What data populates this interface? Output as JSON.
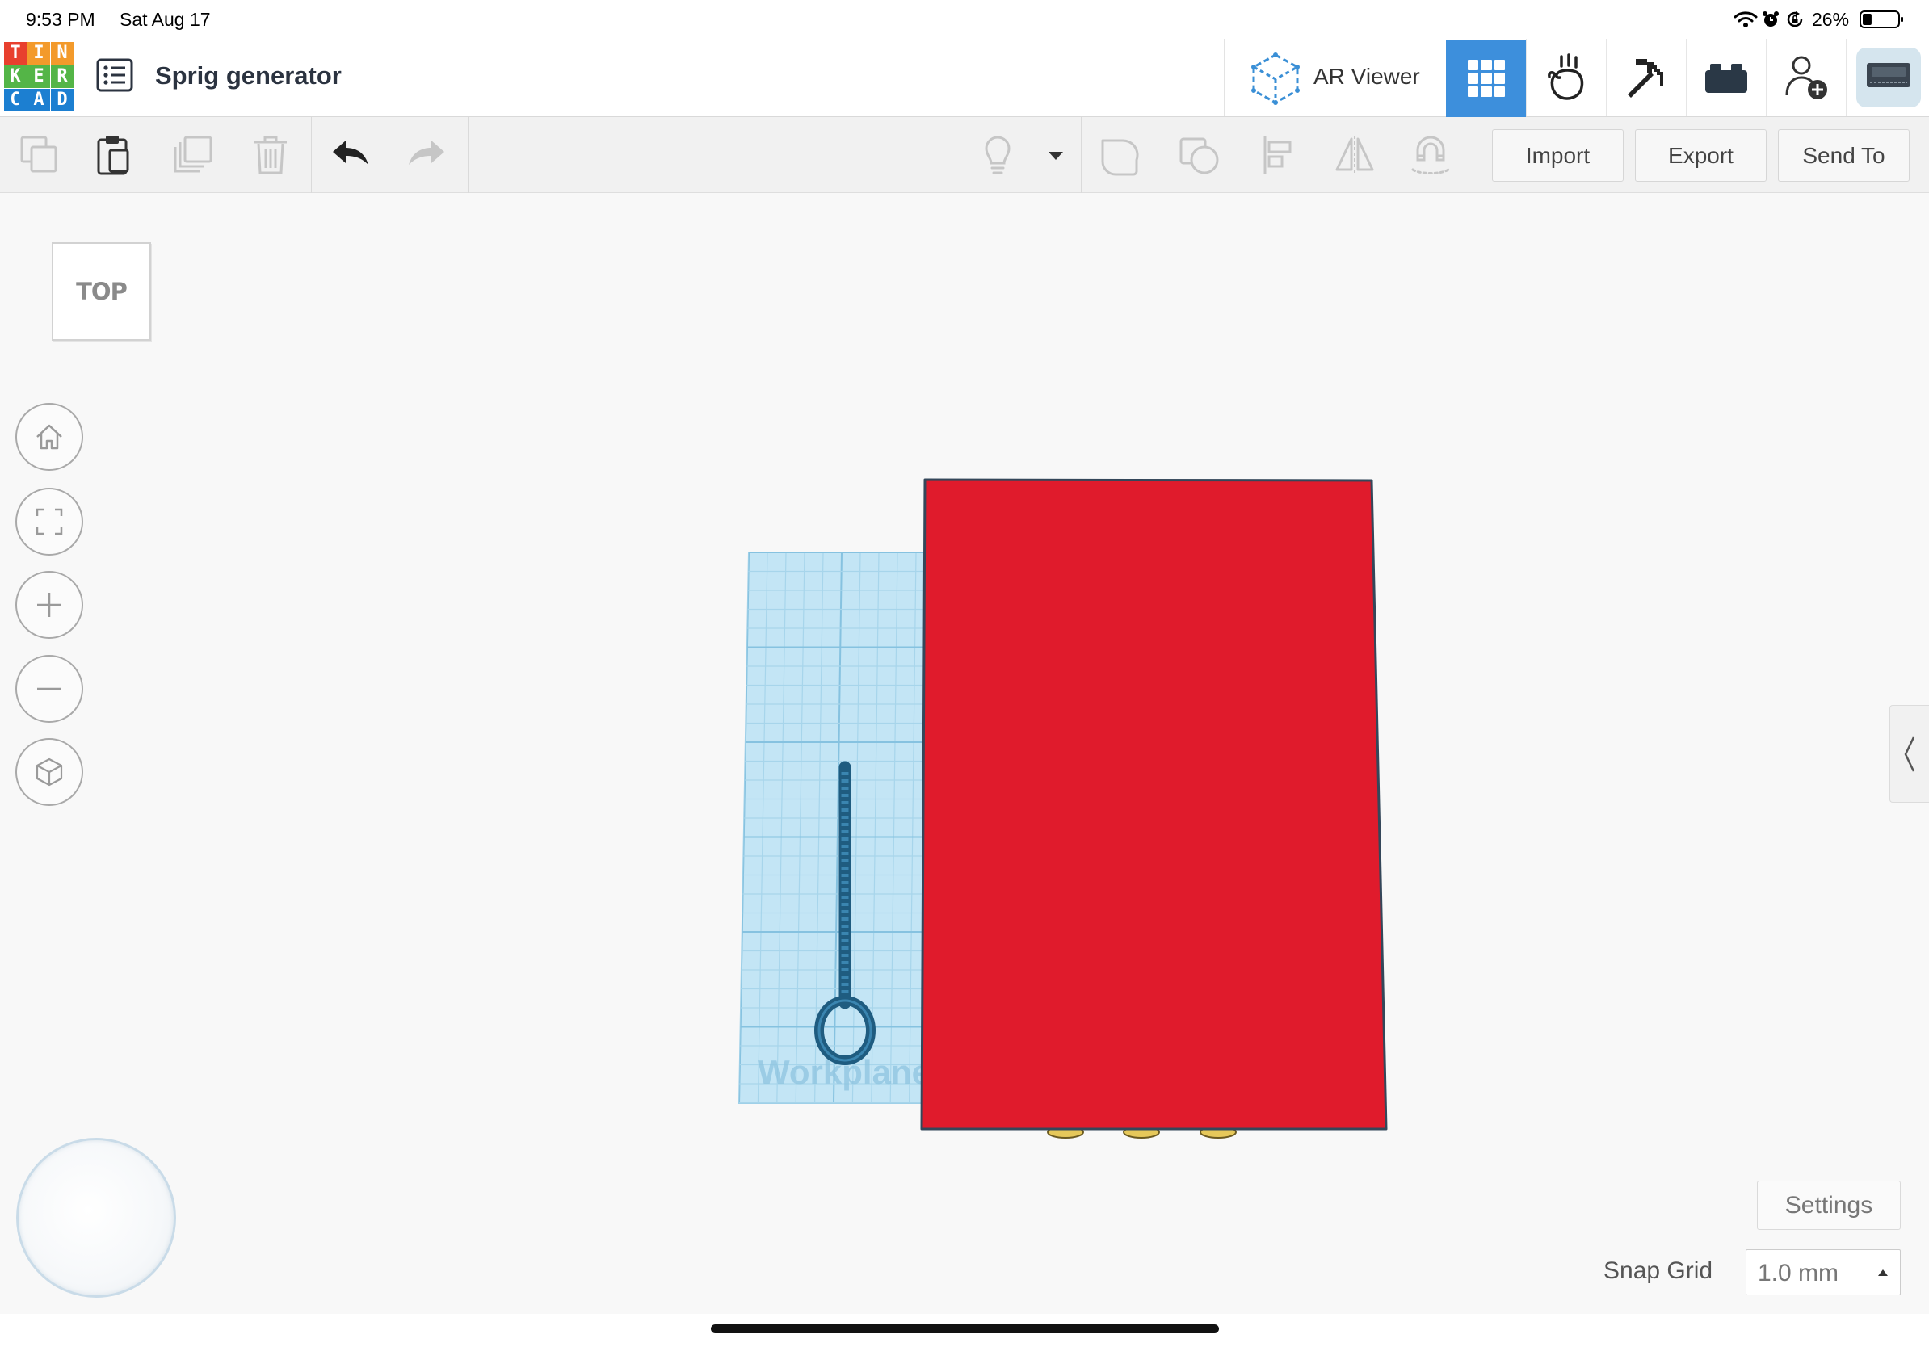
{
  "status_bar": {
    "time": "9:53 PM",
    "date": "Sat Aug 17",
    "battery": "26%",
    "battery_level": 0.26
  },
  "app": {
    "logo": [
      {
        "letter": "T",
        "color": "#e8402e"
      },
      {
        "letter": "I",
        "color": "#f39a2b"
      },
      {
        "letter": "N",
        "color": "#f39a2b"
      },
      {
        "letter": "K",
        "color": "#54b547"
      },
      {
        "letter": "E",
        "color": "#54b547"
      },
      {
        "letter": "R",
        "color": "#54b547"
      },
      {
        "letter": "C",
        "color": "#1c7fd1"
      },
      {
        "letter": "A",
        "color": "#1c7fd1"
      },
      {
        "letter": "D",
        "color": "#1c7fd1"
      }
    ],
    "project_title": "Sprig generator",
    "ar_viewer_label": "AR Viewer",
    "accent_color": "#3d8fdc"
  },
  "toolbar": {
    "import_label": "Import",
    "export_label": "Export",
    "send_to_label": "Send To"
  },
  "viewport": {
    "view_cube_label": "TOP",
    "workplane_label": "Workplane",
    "shape_color": "#e01b2c",
    "workplane_color": "#c3e5f5",
    "spring_color": "#1f5c80"
  },
  "settings": {
    "settings_label": "Settings",
    "snap_grid_label": "Snap Grid",
    "snap_grid_value": "1.0 mm"
  },
  "icons": {
    "header": [
      "list-icon",
      "ar-cube-icon",
      "grid-view-icon",
      "hand-icon",
      "pickaxe-icon",
      "brick-icon",
      "add-user-icon"
    ],
    "toolbar": [
      "copy-icon",
      "paste-icon",
      "duplicate-icon",
      "delete-icon",
      "undo-icon",
      "redo-icon",
      "light-bulb-icon",
      "dropdown-caret-icon",
      "group-icon",
      "ungroup-icon",
      "align-icon",
      "mirror-icon",
      "magnet-icon"
    ],
    "navigation": [
      "home-icon",
      "fit-view-icon",
      "zoom-in-icon",
      "zoom-out-icon",
      "ortho-view-icon"
    ]
  }
}
